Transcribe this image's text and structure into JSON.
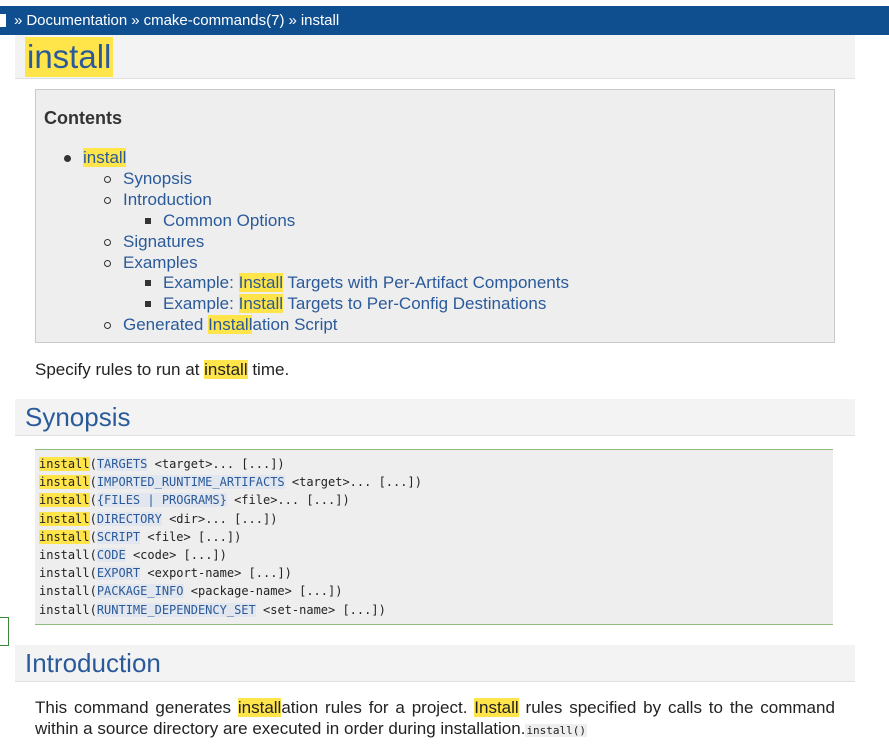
{
  "breadcrumb": {
    "items": [
      "Documentation",
      "cmake-commands(7)",
      "install"
    ],
    "separator": "»"
  },
  "page_title": "install",
  "contents": {
    "title": "Contents",
    "items": [
      {
        "level": 1,
        "parts": [
          {
            "t": "install",
            "hl": true
          }
        ]
      },
      {
        "level": 2,
        "parts": [
          {
            "t": "Synopsis",
            "hl": false
          }
        ]
      },
      {
        "level": 2,
        "parts": [
          {
            "t": "Introduction",
            "hl": false
          }
        ]
      },
      {
        "level": 3,
        "parts": [
          {
            "t": "Common Options",
            "hl": false
          }
        ]
      },
      {
        "level": 2,
        "parts": [
          {
            "t": "Signatures",
            "hl": false
          }
        ]
      },
      {
        "level": 2,
        "parts": [
          {
            "t": "Examples",
            "hl": false
          }
        ]
      },
      {
        "level": 3,
        "parts": [
          {
            "t": "Example: ",
            "hl": false
          },
          {
            "t": "Install",
            "hl": true
          },
          {
            "t": " Targets with Per-Artifact Components",
            "hl": false
          }
        ]
      },
      {
        "level": 3,
        "parts": [
          {
            "t": "Example: ",
            "hl": false
          },
          {
            "t": "Install",
            "hl": true
          },
          {
            "t": " Targets to Per-Config Destinations",
            "hl": false
          }
        ]
      },
      {
        "level": 2,
        "parts": [
          {
            "t": "Generated ",
            "hl": false
          },
          {
            "t": "Install",
            "hl": true
          },
          {
            "t": "ation Script",
            "hl": false
          }
        ]
      }
    ]
  },
  "summary": {
    "before": "Specify rules to run at ",
    "highlight": "install",
    "after": " time."
  },
  "synopsis_heading": "Synopsis",
  "synopsis_code": [
    {
      "cmd": "install",
      "hl": true,
      "kw": "TARGETS",
      "rest": " <target>... [...])"
    },
    {
      "cmd": "install",
      "hl": true,
      "kw": "IMPORTED_RUNTIME_ARTIFACTS",
      "rest": " <target>... [...])"
    },
    {
      "cmd": "install",
      "hl": true,
      "kw": "{FILES | PROGRAMS}",
      "rest": " <file>... [...])"
    },
    {
      "cmd": "install",
      "hl": true,
      "kw": "DIRECTORY",
      "rest": " <dir>... [...])"
    },
    {
      "cmd": "install",
      "hl": true,
      "kw": "SCRIPT",
      "rest": " <file> [...])"
    },
    {
      "cmd": "install",
      "hl": false,
      "kw": "CODE",
      "rest": " <code> [...])"
    },
    {
      "cmd": "install",
      "hl": false,
      "kw": "EXPORT",
      "rest": " <export-name> [...])"
    },
    {
      "cmd": "install",
      "hl": false,
      "kw": "PACKAGE_INFO",
      "rest": " <package-name> [...])"
    },
    {
      "cmd": "install",
      "hl": false,
      "kw": "RUNTIME_DEPENDENCY_SET",
      "rest": " <set-name> [...])"
    }
  ],
  "introduction_heading": "Introduction",
  "introduction": {
    "line1": [
      {
        "t": "This command generates ",
        "hl": false
      },
      {
        "t": "install",
        "hl": true
      },
      {
        "t": "ation rules for a project. ",
        "hl": false
      },
      {
        "t": "Install",
        "hl": true
      },
      {
        "t": " rules specified by calls to the command",
        "hl": false
      }
    ],
    "line2": "within a source directory are executed in order during installation.",
    "line2_code": "install()"
  },
  "colors": {
    "header_bar": "#0f4f8f",
    "link": "#2a5a9a",
    "highlight": "#ffe44a",
    "panel_bg": "#eeeeee"
  }
}
